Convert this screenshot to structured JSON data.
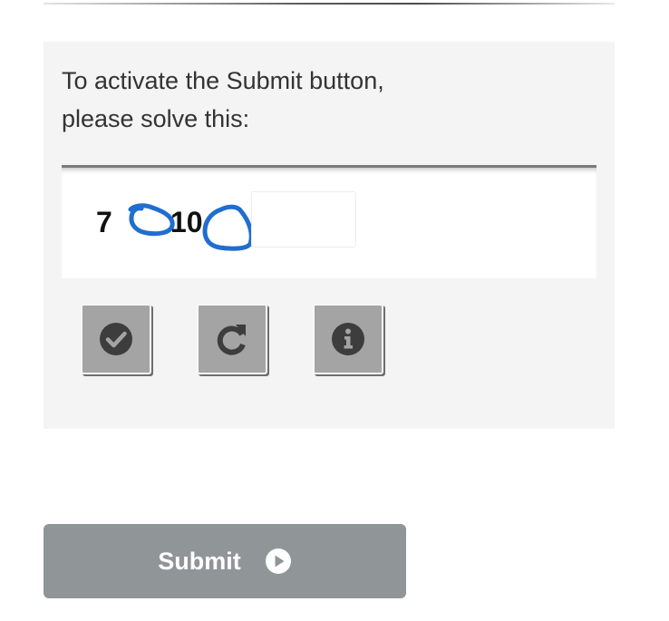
{
  "captcha": {
    "instruction_line1": "To activate the Submit button,",
    "instruction_line2": "please solve this:",
    "operand_a": "7",
    "operand_b": "10",
    "answer_value": "",
    "buttons": {
      "verify_icon": "check-circle-icon",
      "refresh_icon": "refresh-icon",
      "info_icon": "info-circle-icon"
    }
  },
  "form": {
    "submit_label": "Submit",
    "submit_icon": "play-circle-icon"
  },
  "colors": {
    "panel_background": "#f4f4f4",
    "icon_button": "#a4a4a4",
    "icon_glyph": "#3d3d3d",
    "submit_background": "#909597",
    "scribble_ink": "#1f6ed0"
  }
}
